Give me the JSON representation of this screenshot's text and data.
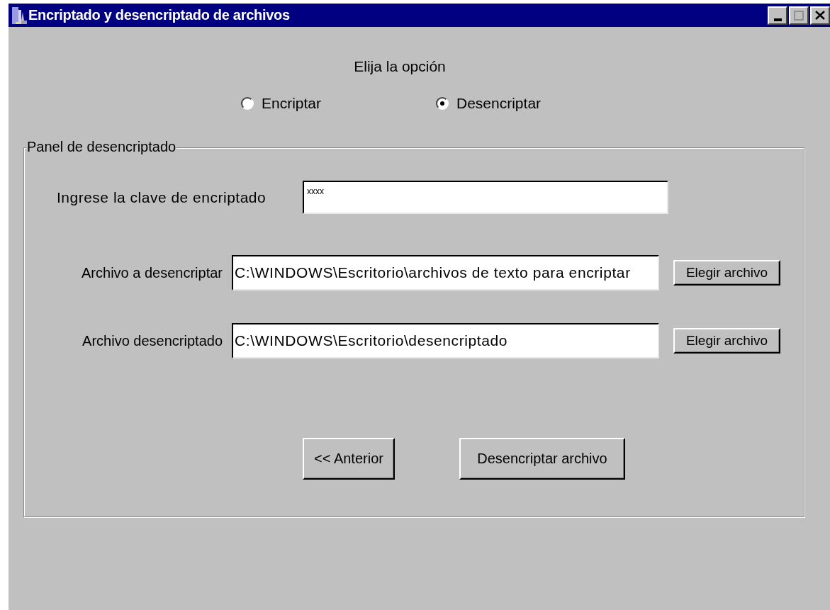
{
  "window": {
    "title": "Encriptado y desencriptado de archivos"
  },
  "prompt": "Elija la opción",
  "options": [
    {
      "label": "Encriptar",
      "selected": false
    },
    {
      "label": "Desencriptar",
      "selected": true
    }
  ],
  "panel": {
    "title": "Panel de desencriptado",
    "key": {
      "label": "Ingrese la clave de encriptado",
      "value": "xxxx"
    },
    "files": [
      {
        "label": "Archivo a desencriptar",
        "value": "C:\\WINDOWS\\Escritorio\\archivos de texto para encriptar",
        "button": "Elegir archivo"
      },
      {
        "label": "Archivo desencriptado",
        "value": "C:\\WINDOWS\\Escritorio\\desencriptado",
        "button": "Elegir archivo"
      }
    ],
    "buttons": [
      "<< Anterior",
      "Desencriptar archivo"
    ]
  }
}
